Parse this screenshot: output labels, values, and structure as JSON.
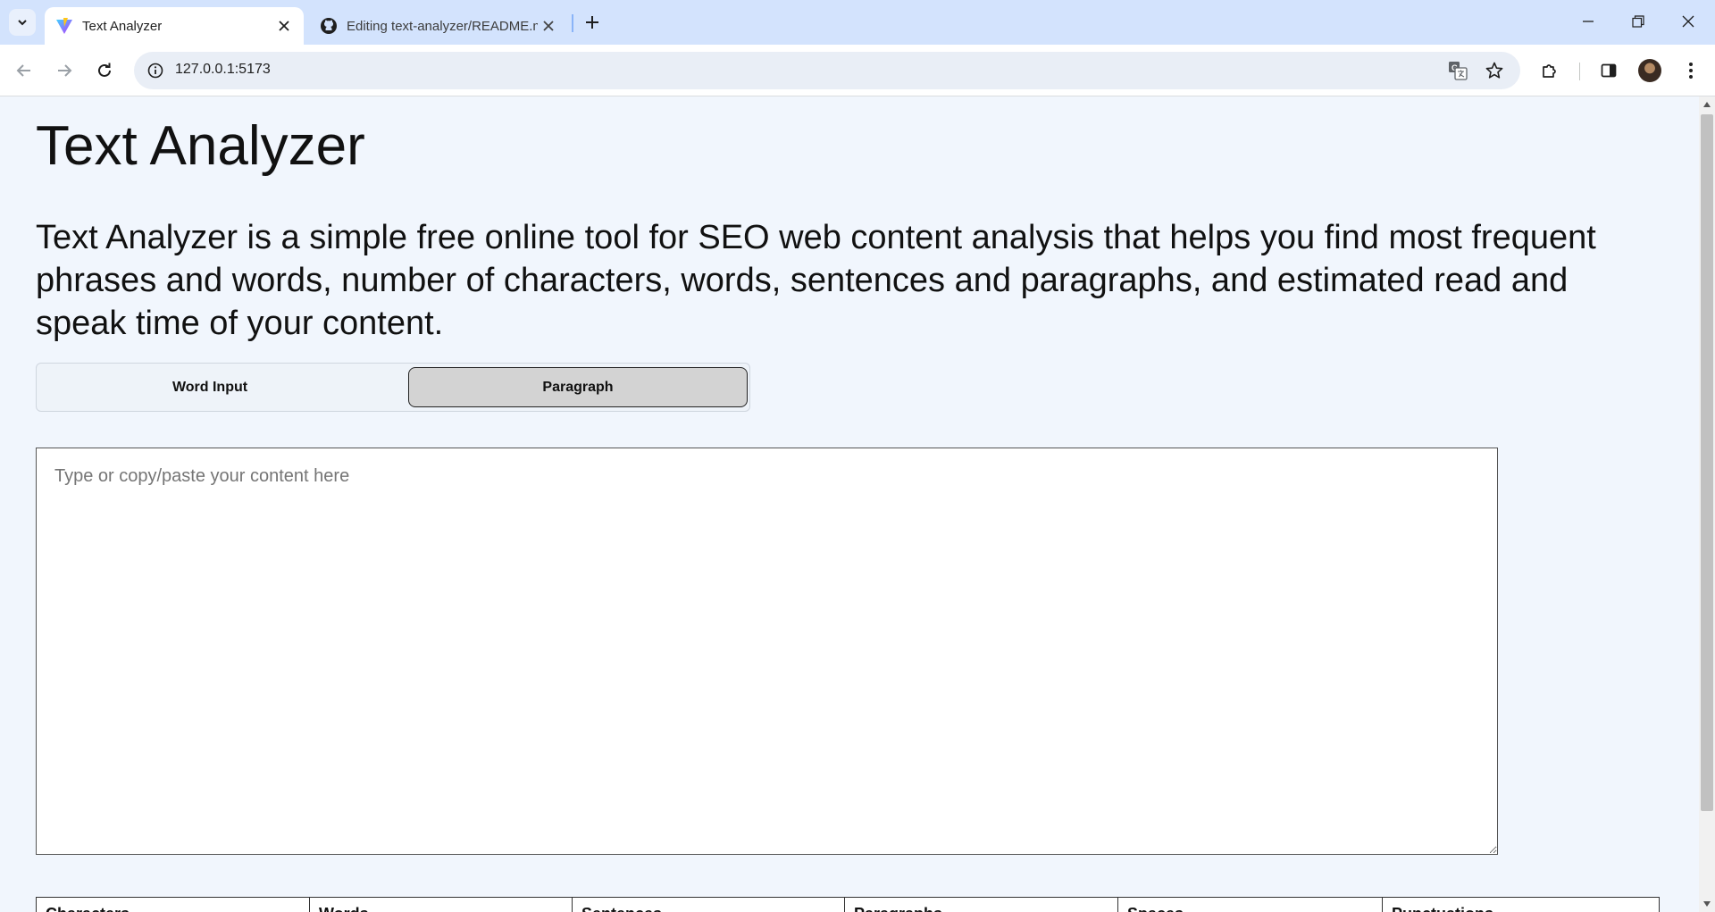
{
  "browser": {
    "tabs": [
      {
        "title": "Text Analyzer",
        "active": true,
        "favicon": "vite-icon"
      },
      {
        "title": "Editing text-analyzer/README.md",
        "active": false,
        "favicon": "github-icon"
      }
    ],
    "url": "127.0.0.1:5173"
  },
  "page": {
    "title": "Text Analyzer",
    "description": "Text Analyzer is a simple free online tool for SEO web content analysis that helps you find most frequent phrases and words, number of characters, words, sentences and paragraphs, and estimated read and speak time of your content.",
    "toggle": {
      "word_label": "Word Input",
      "paragraph_label": "Paragraph",
      "selected": "Paragraph"
    },
    "textarea": {
      "placeholder": "Type or copy/paste your content here",
      "value": ""
    },
    "stats_headers": [
      "Characters",
      "Words",
      "Sentences",
      "Paragraphs",
      "Spaces",
      "Punctuations"
    ]
  },
  "colors": {
    "tabstrip": "#d3e3fd",
    "page_bg": "#f1f6fd",
    "selected_toggle": "#d3d3d3"
  }
}
